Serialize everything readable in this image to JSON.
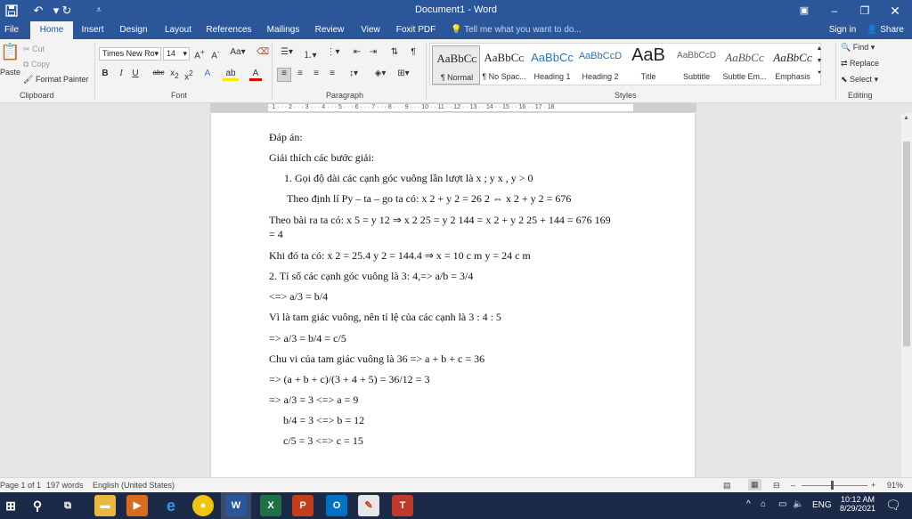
{
  "app": {
    "doc_title": "Document1 - Word",
    "quick_access": [
      "save-icon",
      "undo-icon",
      "redo-icon",
      "customize-icon"
    ],
    "window_controls": [
      "ribbon-display-icon",
      "minimize-icon",
      "restore-icon",
      "close-icon"
    ]
  },
  "tabs": {
    "file": "File",
    "items": [
      "Home",
      "Insert",
      "Design",
      "Layout",
      "References",
      "Mailings",
      "Review",
      "View",
      "Foxit PDF"
    ],
    "active": "Home",
    "tell_me": "Tell me what you want to do...",
    "sign_in": "Sign in",
    "share": "Share"
  },
  "ribbon": {
    "clipboard": {
      "label": "Clipboard",
      "paste": "Paste",
      "cut": "Cut",
      "copy": "Copy",
      "format_painter": "Format Painter"
    },
    "font": {
      "label": "Font",
      "name": "Times New Ro",
      "size": "14"
    },
    "paragraph": {
      "label": "Paragraph"
    },
    "styles": {
      "label": "Styles",
      "items": [
        {
          "sample": "AaBbCᴄ",
          "name": "¶ Normal"
        },
        {
          "sample": "AaBbCᴄ",
          "name": "¶ No Spac..."
        },
        {
          "sample": "AaBbCᴄ",
          "name": "Heading 1"
        },
        {
          "sample": "AaBbCcD",
          "name": "Heading 2"
        },
        {
          "sample": "AaB",
          "name": "Title"
        },
        {
          "sample": "AaBbCcD",
          "name": "Subtitle"
        },
        {
          "sample": "AaBbCᴄ",
          "name": "Subtle Em..."
        },
        {
          "sample": "AaBbCᴄ",
          "name": "Emphasis"
        }
      ]
    },
    "editing": {
      "label": "Editing",
      "find": "Find",
      "replace": "Replace",
      "select": "Select"
    }
  },
  "ruler": {
    "ticks": "· 1 · · · 2 · · · 3 · · · 4 · · · 5 · · · 6 · · · 7 · · · 8 · · · 9 · · · 10 · · 11 · · 12 · · 13 · · 14 · · 15 · · 16 · · 17 · 18"
  },
  "document": {
    "lines": [
      "Đáp án:",
      "Giải thích các bước giải:",
      "1.  Gọi độ dài các cạnh góc vuông lần lượt là  x ; y x , y > 0",
      "Theo định lí Py – ta – go ta có:  x 2 + y 2 = 26 2 ⇔ x 2 + y 2 = 676",
      "Theo bài ra ta có:  x 5 = y 12 ⇒ x 2 25 = y 2 144 = x 2 + y 2 25 + 144 = 676 169",
      "= 4",
      "Khi đó ta có:  x 2 = 25.4 y 2 = 144.4 ⇒ x = 10 c m y = 24 c m",
      "2. Tỉ số các cạnh góc vuông là 3: 4,=> a/b = 3/4",
      "<=> a/3 = b/4",
      "Vì là tam giác vuông, nên tỉ lệ của các cạnh là 3 : 4 : 5",
      "=> a/3 = b/4 = c/5",
      "Chu vi của tam giác vuông là 36 => a + b + c = 36",
      "=> (a + b + c)/(3 + 4 + 5) = 36/12 = 3",
      "=> a/3 = 3 <=> a = 9",
      "b/4 = 3 <=> b = 12",
      "c/5 = 3 <=> c = 15"
    ]
  },
  "status": {
    "page": "Page 1 of 1",
    "words": "197 words",
    "language": "English (United States)",
    "zoom": "91%"
  },
  "taskbar": {
    "apps": [
      "windows-start-icon",
      "search-icon",
      "task-view-icon",
      "file-explorer-icon",
      "media-player-icon",
      "edge-icon",
      "chrome-icon",
      "word-icon",
      "excel-icon",
      "powerpoint-icon",
      "outlook-icon",
      "paint-icon",
      "teams-icon"
    ],
    "lang": "ENG",
    "time": "10:12 AM",
    "date": "8/29/2021"
  },
  "colors": {
    "word_blue": "#2b579a",
    "taskbar": "#1b2a47"
  }
}
